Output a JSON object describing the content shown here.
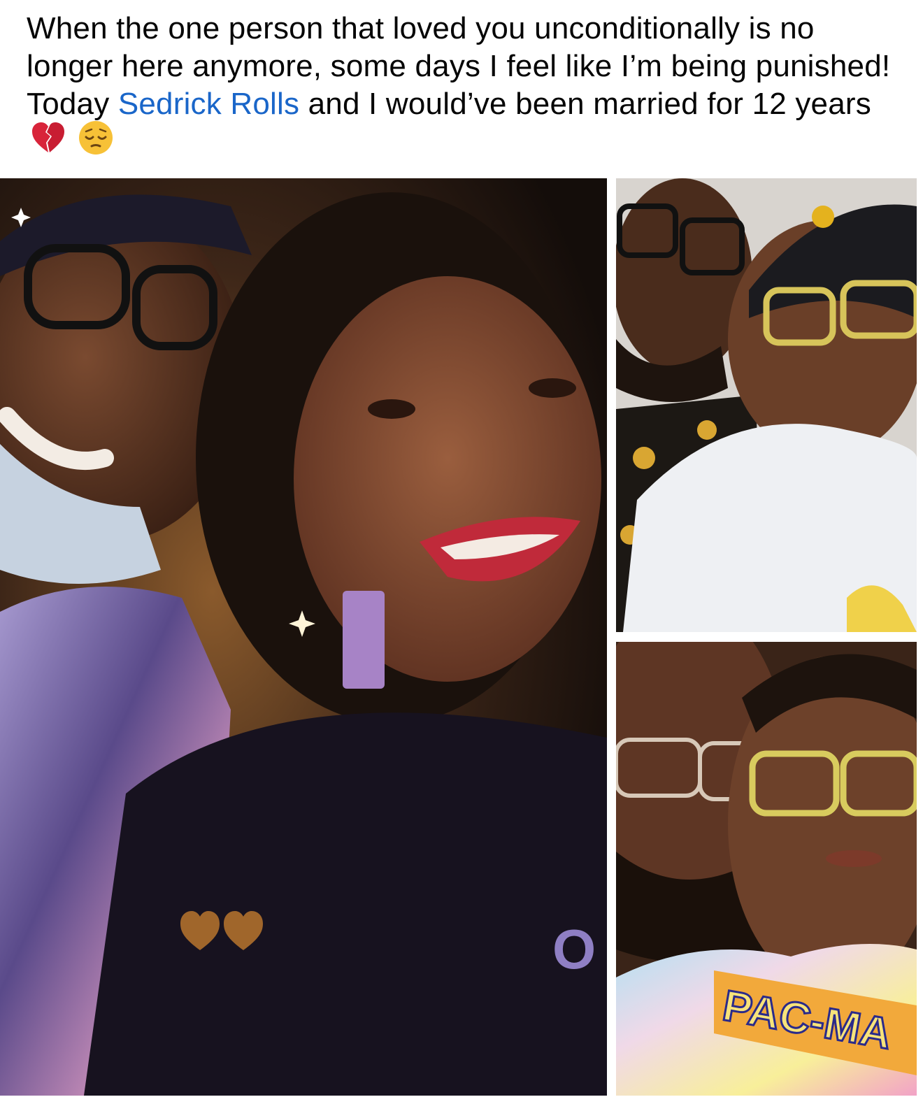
{
  "post": {
    "text_before": "When the one person that loved you unconditionally is no longer here anymore, some days I feel like I’m being punished! Today ",
    "mention": "Sedrick Rolls",
    "text_after": " and I would’ve been married for 12 years",
    "emojis": [
      "broken-heart-icon",
      "pensive-face-icon"
    ]
  },
  "photos": [
    {
      "name": "main-selfie",
      "overlay_emojis": [
        "brown-heart-icon",
        "brown-heart-icon"
      ]
    },
    {
      "name": "top-right-selfie"
    },
    {
      "name": "bottom-right-selfie",
      "shirt_text": "PAC-MA"
    }
  ],
  "colors": {
    "text": "#050505",
    "mention": "#1a66c9",
    "brown_heart": "#a0662b",
    "broken_heart": "#d8243a",
    "pensive_face": "#f7c137"
  }
}
